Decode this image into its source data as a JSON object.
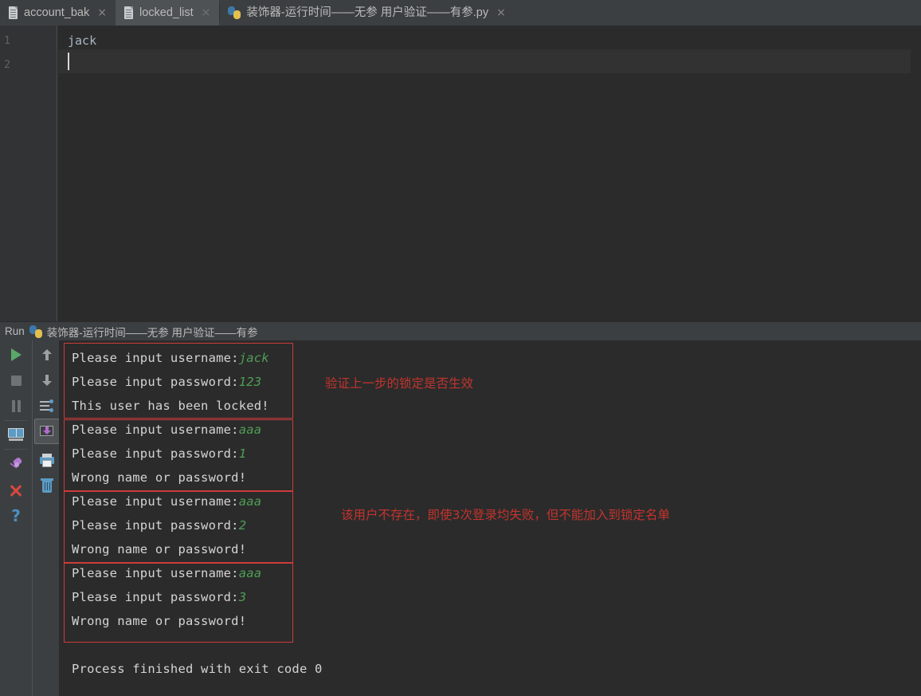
{
  "tabs": [
    {
      "label": "account_bak",
      "icon": "file-icon",
      "close": "×",
      "active": false
    },
    {
      "label": "locked_list",
      "icon": "file-icon",
      "close": "×",
      "active": true
    },
    {
      "label": "装饰器-运行时间——无参 用户验证——有参.py",
      "icon": "python-icon",
      "close": "×",
      "active": false
    }
  ],
  "editor": {
    "line_numbers": [
      "1",
      "2"
    ],
    "lines": [
      "jack",
      ""
    ]
  },
  "run_panel": {
    "label": "Run",
    "icon": "python-icon",
    "config_name": "装饰器-运行时间——无参 用户验证——有参"
  },
  "toolbar_left": [
    {
      "name": "rerun-button",
      "icon": "play-icon"
    },
    {
      "name": "stop-button",
      "icon": "stop-icon"
    },
    {
      "name": "pause-button",
      "icon": "pause-icon"
    },
    {
      "name": "show-console-button",
      "icon": "console-icon"
    },
    {
      "name": "pin-tab-button",
      "icon": "pin-icon"
    },
    {
      "name": "close-button",
      "icon": "close-x-icon"
    },
    {
      "name": "help-button",
      "icon": "question-mark-icon"
    }
  ],
  "toolbar_right": [
    {
      "name": "up-the-stack-trace-button",
      "icon": "arrow-up-icon"
    },
    {
      "name": "down-the-stack-trace-button",
      "icon": "arrow-down-icon"
    },
    {
      "name": "soft-wrap-button",
      "icon": "soft-wrap-icon"
    },
    {
      "name": "scroll-to-end-button",
      "icon": "scroll-to-end-icon",
      "selected": true
    },
    {
      "name": "print-button",
      "icon": "print-icon"
    },
    {
      "name": "clear-all-button",
      "icon": "trash-icon"
    }
  ],
  "console": {
    "blocks": [
      {
        "lines": [
          {
            "prompt": "Please input username:",
            "value": "jack"
          },
          {
            "prompt": "Please input password:",
            "value": "123"
          },
          {
            "prompt": "This user has been locked!",
            "value": ""
          }
        ]
      },
      {
        "lines": [
          {
            "prompt": "Please input username:",
            "value": "aaa"
          },
          {
            "prompt": "Please input password:",
            "value": "1"
          },
          {
            "prompt": "Wrong name or password!",
            "value": ""
          }
        ]
      },
      {
        "lines": [
          {
            "prompt": "Please input username:",
            "value": "aaa"
          },
          {
            "prompt": "Please input password:",
            "value": "2"
          },
          {
            "prompt": "Wrong name or password!",
            "value": ""
          }
        ]
      },
      {
        "lines": [
          {
            "prompt": "Please input username:",
            "value": "aaa"
          },
          {
            "prompt": "Please input password:",
            "value": "3"
          },
          {
            "prompt": "Wrong name or password!",
            "value": ""
          }
        ]
      }
    ],
    "exit_line": "Process finished with exit code 0",
    "annotations": [
      {
        "text": "验证上一步的锁定是否生效"
      },
      {
        "text": "该用户不存在，即使3次登录均失败，但不能加入到锁定名单"
      }
    ]
  },
  "colors": {
    "bg_chrome": "#3c3f41",
    "bg_editor": "#2b2b2b",
    "text": "#bbbbbb",
    "console_text": "#d4d4d4",
    "input_value": "#4f9d55",
    "annotation": "#c3342e",
    "box_border": "#cc3b3b",
    "play_green": "#59a869"
  }
}
